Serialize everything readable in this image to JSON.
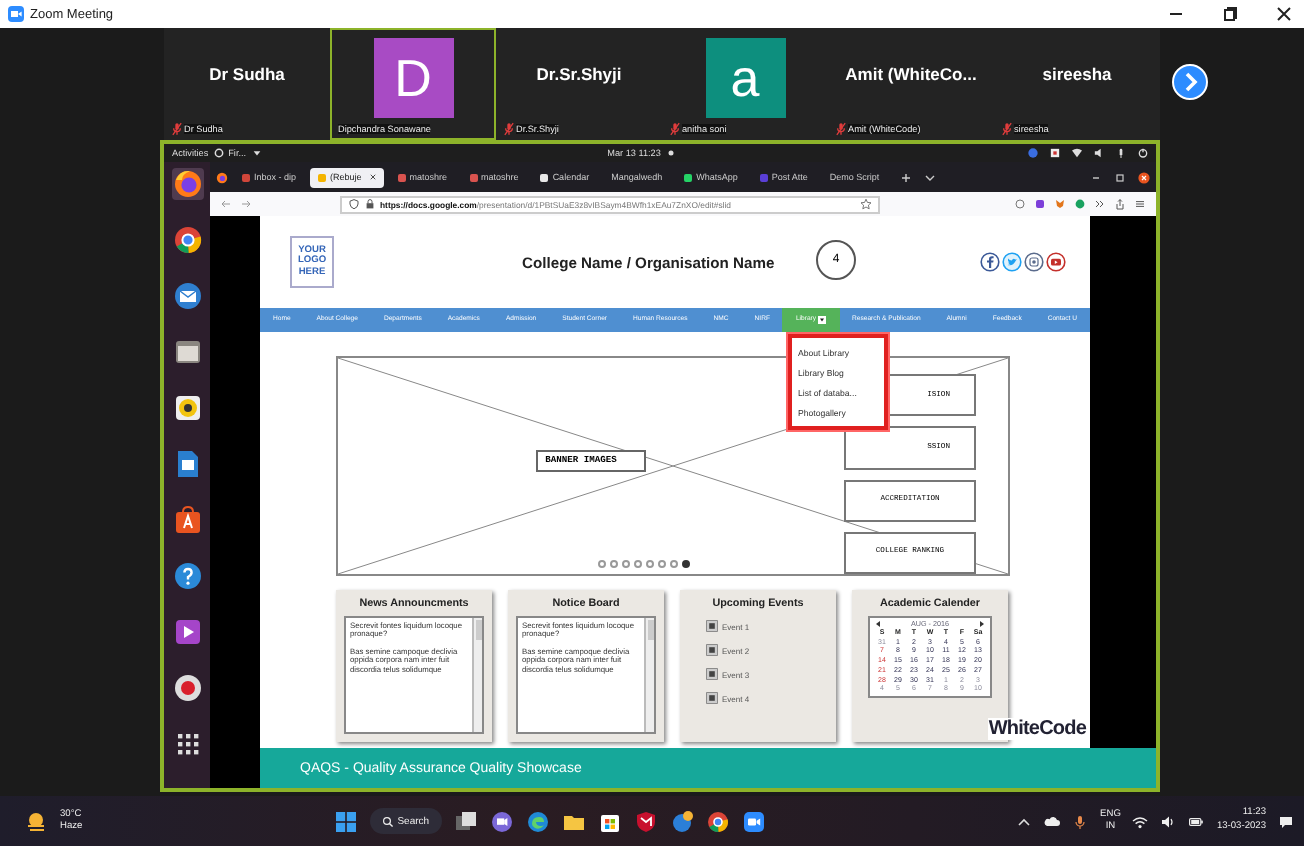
{
  "window": {
    "title": "Zoom Meeting"
  },
  "participants": [
    {
      "kind": "name",
      "display": "Dr Sudha",
      "label": "Dr Sudha",
      "muted": true,
      "selected": false
    },
    {
      "kind": "avatar",
      "display": "D",
      "color": "#a84bc4",
      "label": "Dipchandra Sonawane",
      "muted": false,
      "selected": true
    },
    {
      "kind": "name",
      "display": "Dr.Sr.Shyji",
      "label": "Dr.Sr.Shyji",
      "muted": true,
      "selected": false
    },
    {
      "kind": "avatar",
      "display": "a",
      "color": "#0d8f7e",
      "label": "anitha soni",
      "muted": true,
      "selected": false
    },
    {
      "kind": "name",
      "display": "Amit  (WhiteCo...",
      "label": "Amit (WhiteCode)",
      "muted": true,
      "selected": false
    },
    {
      "kind": "name",
      "display": "sireesha",
      "label": "sireesha",
      "muted": true,
      "selected": false
    }
  ],
  "desktop": {
    "activities": "Activities",
    "app": "Fir...",
    "clock": "Mar 13  11:23"
  },
  "browser": {
    "tabs": [
      {
        "kind": "mail",
        "label": "Inbox - dip",
        "selected": false
      },
      {
        "kind": "slides",
        "label": "(Rebuje",
        "selected": true
      },
      {
        "kind": "pdf",
        "label": "matoshre",
        "selected": false
      },
      {
        "kind": "pdf",
        "label": "matoshre",
        "selected": false
      },
      {
        "kind": "doc",
        "label": "Calendar",
        "selected": false
      },
      {
        "kind": "plain",
        "label": "Mangalwedh",
        "selected": false
      },
      {
        "kind": "whatsapp",
        "label": "WhatsApp",
        "selected": false
      },
      {
        "kind": "zoho",
        "label": "Post Atte",
        "selected": false
      },
      {
        "kind": "plain",
        "label": "Demo Script",
        "selected": false
      }
    ],
    "url_host": "https://docs.google.com",
    "url_path": "/presentation/d/1PBtSUaE3z8vIBSaym4BWfh1xEAu7ZnXO/edit#slid"
  },
  "slide": {
    "logo": "YOUR LOGO HERE",
    "title": "College Name / Organisation Name",
    "callout": "4",
    "nav": [
      {
        "label": "Home",
        "selected": false
      },
      {
        "label": "About College",
        "selected": false
      },
      {
        "label": "Departments",
        "selected": false
      },
      {
        "label": "Academics",
        "selected": false
      },
      {
        "label": "Admission",
        "selected": false
      },
      {
        "label": "Student Corner",
        "selected": false
      },
      {
        "label": "Human Resources",
        "selected": false
      },
      {
        "label": "NMC",
        "selected": false
      },
      {
        "label": "NIRF",
        "selected": false
      },
      {
        "label": "Library",
        "selected": true
      },
      {
        "label": "Research & Publication",
        "selected": false
      },
      {
        "label": "Alumni",
        "selected": false
      },
      {
        "label": "Feedback",
        "selected": false
      },
      {
        "label": "Contact U",
        "selected": false
      }
    ],
    "menu": [
      "About Library",
      "Library Blog",
      "List of databa...",
      "Photogallery"
    ],
    "banner": {
      "caption": "BANNER IMAGES",
      "boxes": [
        "ISION",
        "SSION",
        "ACCREDITATION",
        "COLLEGE RANKING"
      ],
      "dots": [
        {
          "selected": false
        },
        {
          "selected": false
        },
        {
          "selected": false
        },
        {
          "selected": false
        },
        {
          "selected": false
        },
        {
          "selected": false
        },
        {
          "selected": false
        },
        {
          "selected": true
        }
      ]
    },
    "cards": [
      {
        "kind": "text",
        "title": "News Announcments",
        "paragraphs": [
          "Secrevit fontes liquidum locoque pronaque?",
          "Bas semine campoque declivia oppida corpora nam inter fuit discordia telus solidumque"
        ]
      },
      {
        "kind": "text",
        "title": "Notice Board",
        "paragraphs": [
          "Secrevit fontes liquidum locoque pronaque?",
          "Bas semine campoque declivia oppida corpora nam inter fuit discordia telus solidumque"
        ]
      },
      {
        "kind": "events",
        "title": "Upcoming Events",
        "events": [
          "Event 1",
          "Event 2",
          "Event 3",
          "Event 4"
        ]
      },
      {
        "kind": "calendar",
        "title": "Academic Calender",
        "month": "AUG - 2016",
        "weekdays": [
          "S",
          "M",
          "T",
          "W",
          "T",
          "F",
          "Sa"
        ],
        "weeks": [
          [
            {
              "d": "31",
              "outside": true
            },
            {
              "d": "1",
              "outside": false
            },
            {
              "d": "2",
              "outside": false
            },
            {
              "d": "3",
              "outside": false
            },
            {
              "d": "4",
              "outside": false
            },
            {
              "d": "5",
              "outside": false
            },
            {
              "d": "6",
              "outside": false
            }
          ],
          [
            {
              "d": "7",
              "outside": false
            },
            {
              "d": "8",
              "outside": false
            },
            {
              "d": "9",
              "outside": false
            },
            {
              "d": "10",
              "outside": false
            },
            {
              "d": "11",
              "outside": false
            },
            {
              "d": "12",
              "outside": false
            },
            {
              "d": "13",
              "outside": false
            }
          ],
          [
            {
              "d": "14",
              "outside": false
            },
            {
              "d": "15",
              "outside": false
            },
            {
              "d": "16",
              "outside": false
            },
            {
              "d": "17",
              "outside": false
            },
            {
              "d": "18",
              "outside": false
            },
            {
              "d": "19",
              "outside": false
            },
            {
              "d": "20",
              "outside": false
            }
          ],
          [
            {
              "d": "21",
              "outside": false
            },
            {
              "d": "22",
              "outside": false
            },
            {
              "d": "23",
              "outside": false
            },
            {
              "d": "24",
              "outside": false
            },
            {
              "d": "25",
              "outside": false
            },
            {
              "d": "26",
              "outside": false
            },
            {
              "d": "27",
              "outside": false
            }
          ],
          [
            {
              "d": "28",
              "outside": false
            },
            {
              "d": "29",
              "outside": false
            },
            {
              "d": "30",
              "outside": false
            },
            {
              "d": "31",
              "outside": false
            },
            {
              "d": "1",
              "outside": true
            },
            {
              "d": "2",
              "outside": true
            },
            {
              "d": "3",
              "outside": true
            }
          ],
          [
            {
              "d": "4",
              "outside": true
            },
            {
              "d": "5",
              "outside": true
            },
            {
              "d": "6",
              "outside": true
            },
            {
              "d": "7",
              "outside": true
            },
            {
              "d": "8",
              "outside": true
            },
            {
              "d": "9",
              "outside": true
            },
            {
              "d": "10",
              "outside": true
            }
          ]
        ]
      }
    ],
    "brand": "WhiteCode",
    "footer": "QAQS - Quality Assurance Quality Showcase"
  },
  "taskbar": {
    "temperature": "30°C",
    "weather": "Haze",
    "search": "Search",
    "language": "ENG",
    "region": "IN",
    "time": "11:23",
    "date": "13-03-2023"
  }
}
